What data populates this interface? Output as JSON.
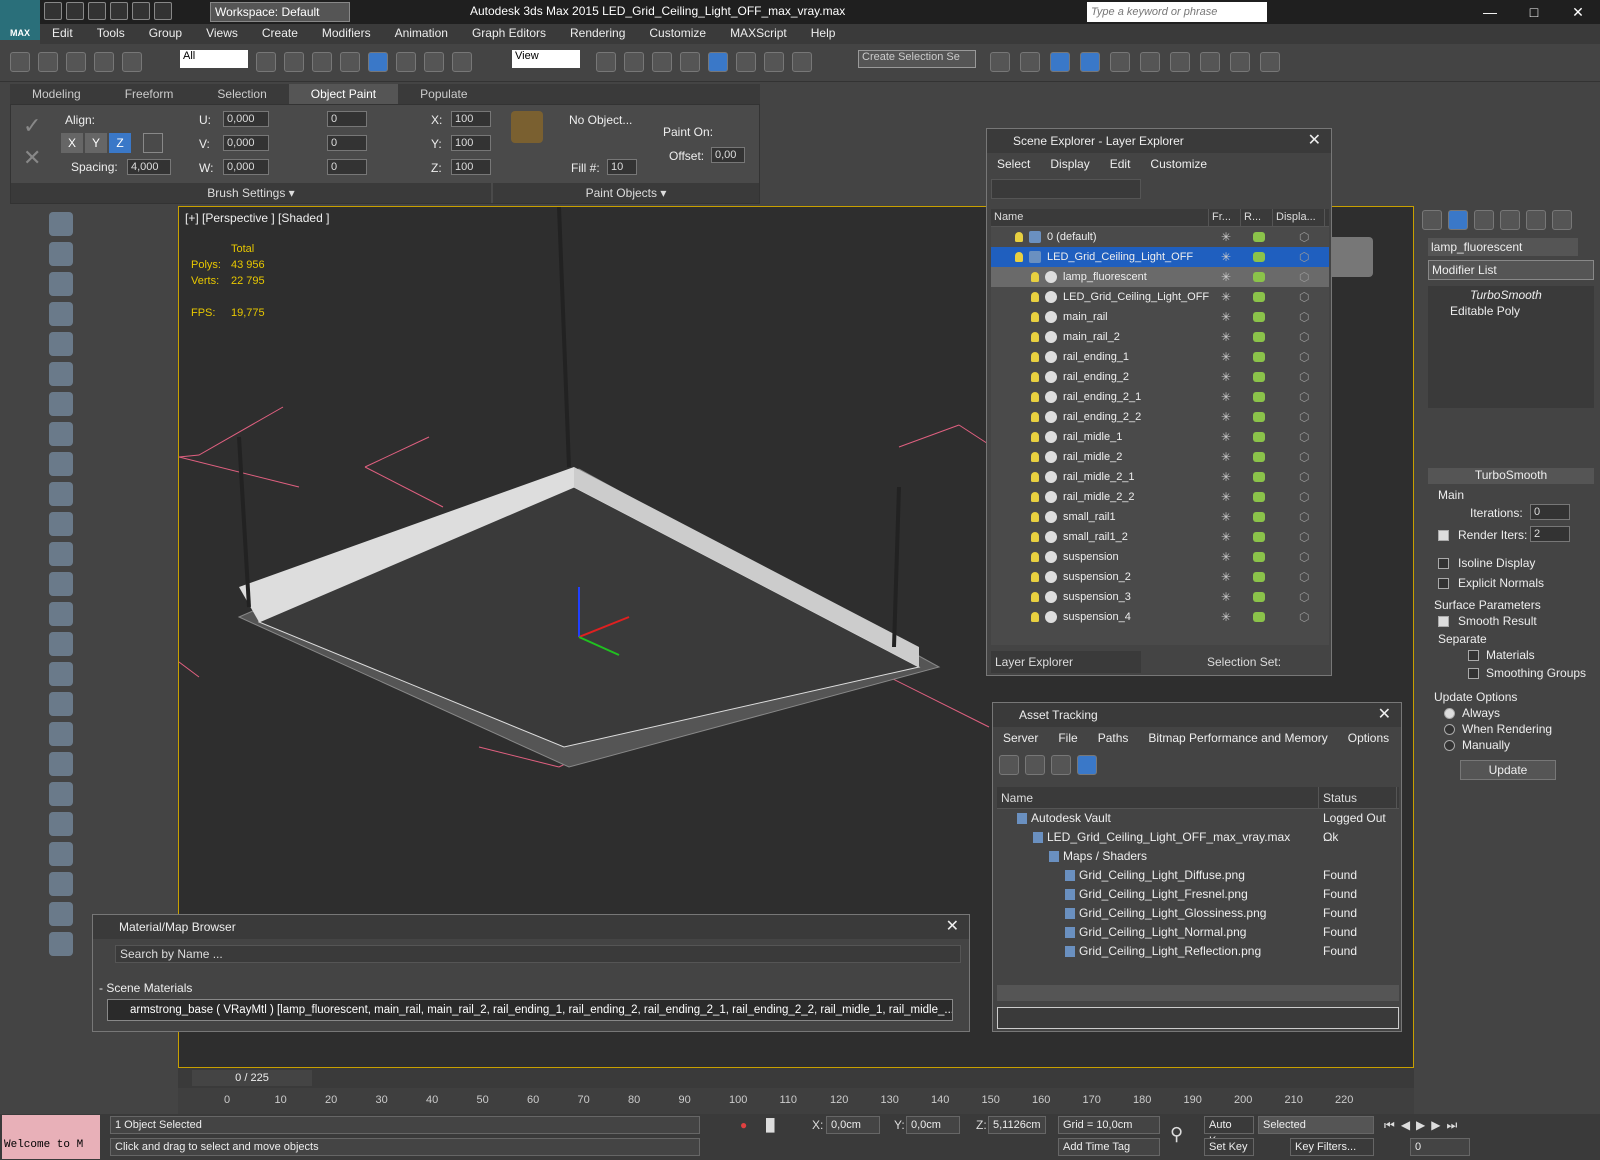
{
  "app": {
    "title": "Autodesk 3ds Max  2015    LED_Grid_Ceiling_Light_OFF_max_vray.max",
    "logo": "MAX",
    "workspace": "Workspace: Default",
    "search_placeholder": "Type a keyword or phrase"
  },
  "menubar": [
    "Edit",
    "Tools",
    "Group",
    "Views",
    "Create",
    "Modifiers",
    "Animation",
    "Graph Editors",
    "Rendering",
    "Customize",
    "MAXScript",
    "Help"
  ],
  "toolbar": {
    "selection_filter": "All",
    "reference_coord": "View",
    "selection_set_placeholder": "Create Selection Se"
  },
  "ribbon": {
    "tabs": [
      "Modeling",
      "Freeform",
      "Selection",
      "Object Paint",
      "Populate"
    ],
    "active_tab": "Object Paint",
    "align_label": "Align:",
    "axes": [
      "X",
      "Y",
      "Z"
    ],
    "spacing_label": "Spacing:",
    "spacing_value": "4,000",
    "u_label": "U:",
    "u_value": "0,000",
    "v_label": "V:",
    "v_value": "0,000",
    "w_label": "W:",
    "w_value": "0,000",
    "x_rot": "0",
    "y_rot": "0",
    "z_rot": "0",
    "x_scale_label": "X:",
    "x_scale": "100",
    "y_scale_label": "Y:",
    "y_scale": "100",
    "z_scale_label": "Z:",
    "z_scale": "100",
    "no_object": "No Object...",
    "fill_label": "Fill #:",
    "fill_value": "10",
    "paint_on_label": "Paint On:",
    "offset_label": "Offset:",
    "offset_value": "0,00",
    "brush_settings": "Brush Settings",
    "paint_objects": "Paint Objects"
  },
  "viewport": {
    "label": "[+] [Perspective ] [Shaded ]",
    "stats_total": "Total",
    "polys_label": "Polys:",
    "polys": "43 956",
    "verts_label": "Verts:",
    "verts": "22 795",
    "fps_label": "FPS:",
    "fps": "19,775"
  },
  "scene_explorer": {
    "title": "Scene Explorer - Layer Explorer",
    "menu": [
      "Select",
      "Display",
      "Edit",
      "Customize"
    ],
    "columns": [
      "Name",
      "Fr...",
      "R...",
      "Displa..."
    ],
    "rows": [
      {
        "name": "0 (default)",
        "level": 0,
        "kind": "layer"
      },
      {
        "name": "LED_Grid_Ceiling_Light_OFF",
        "level": 0,
        "kind": "layer",
        "selected": true
      },
      {
        "name": "lamp_fluorescent",
        "level": 1,
        "kind": "object",
        "highlight": true
      },
      {
        "name": "LED_Grid_Ceiling_Light_OFF",
        "level": 1,
        "kind": "group"
      },
      {
        "name": "main_rail",
        "level": 1,
        "kind": "object"
      },
      {
        "name": "main_rail_2",
        "level": 1,
        "kind": "object"
      },
      {
        "name": "rail_ending_1",
        "level": 1,
        "kind": "object"
      },
      {
        "name": "rail_ending_2",
        "level": 1,
        "kind": "object"
      },
      {
        "name": "rail_ending_2_1",
        "level": 1,
        "kind": "object"
      },
      {
        "name": "rail_ending_2_2",
        "level": 1,
        "kind": "object"
      },
      {
        "name": "rail_midle_1",
        "level": 1,
        "kind": "object"
      },
      {
        "name": "rail_midle_2",
        "level": 1,
        "kind": "object"
      },
      {
        "name": "rail_midle_2_1",
        "level": 1,
        "kind": "object"
      },
      {
        "name": "rail_midle_2_2",
        "level": 1,
        "kind": "object"
      },
      {
        "name": "small_rail1",
        "level": 1,
        "kind": "object"
      },
      {
        "name": "small_rail1_2",
        "level": 1,
        "kind": "object"
      },
      {
        "name": "suspension",
        "level": 1,
        "kind": "object"
      },
      {
        "name": "suspension_2",
        "level": 1,
        "kind": "object"
      },
      {
        "name": "suspension_3",
        "level": 1,
        "kind": "object"
      },
      {
        "name": "suspension_4",
        "level": 1,
        "kind": "object"
      }
    ],
    "footer_explorer": "Layer Explorer",
    "footer_selset": "Selection Set:"
  },
  "asset_tracking": {
    "title": "Asset Tracking",
    "menu": [
      "Server",
      "File",
      "Paths",
      "Bitmap Performance and Memory",
      "Options"
    ],
    "columns": [
      "Name",
      "Status"
    ],
    "rows": [
      {
        "name": "Autodesk Vault",
        "status": "Logged Out ...",
        "indent": 1
      },
      {
        "name": "LED_Grid_Ceiling_Light_OFF_max_vray.max",
        "status": "Ok",
        "indent": 2
      },
      {
        "name": "Maps / Shaders",
        "status": "",
        "indent": 3
      },
      {
        "name": "Grid_Ceiling_Light_Diffuse.png",
        "status": "Found",
        "indent": 4
      },
      {
        "name": "Grid_Ceiling_Light_Fresnel.png",
        "status": "Found",
        "indent": 4
      },
      {
        "name": "Grid_Ceiling_Light_Glossiness.png",
        "status": "Found",
        "indent": 4
      },
      {
        "name": "Grid_Ceiling_Light_Normal.png",
        "status": "Found",
        "indent": 4
      },
      {
        "name": "Grid_Ceiling_Light_Reflection.png",
        "status": "Found",
        "indent": 4
      }
    ]
  },
  "material_browser": {
    "title": "Material/Map Browser",
    "search_placeholder": "Search by Name ...",
    "section": "- Scene Materials",
    "item": "armstrong_base  ( VRayMtl ) [lamp_fluorescent, main_rail, main_rail_2, rail_ending_1, rail_ending_2, rail_ending_2_1, rail_ending_2_2, rail_midle_1, rail_midle_..."
  },
  "command_panel": {
    "object_name": "lamp_fluorescent",
    "modifier_list": "Modifier List",
    "stack": [
      "TurboSmooth",
      "Editable Poly"
    ],
    "rollout_title": "TurboSmooth",
    "main_label": "Main",
    "iterations_label": "Iterations:",
    "iterations": "0",
    "render_iters_label": "Render Iters:",
    "render_iters": "2",
    "isoline": "Isoline Display",
    "explicit_normals": "Explicit Normals",
    "surface_params": "Surface Parameters",
    "smooth_result": "Smooth Result",
    "separate": "Separate",
    "materials": "Materials",
    "smoothing_groups": "Smoothing Groups",
    "update_options": "Update Options",
    "always": "Always",
    "when_rendering": "When Rendering",
    "manually": "Manually",
    "update_btn": "Update"
  },
  "timeline": {
    "frame": "0 / 225",
    "ticks": [
      "0",
      "10",
      "20",
      "30",
      "40",
      "50",
      "60",
      "70",
      "80",
      "90",
      "100",
      "110",
      "120",
      "130",
      "140",
      "150",
      "160",
      "170",
      "180",
      "190",
      "200",
      "210",
      "220"
    ]
  },
  "status": {
    "welcome": "Welcome to M",
    "selected": "1 Object Selected",
    "prompt": "Click and drag to select and move objects",
    "x_label": "X:",
    "x": "0,0cm",
    "y_label": "Y:",
    "y": "0,0cm",
    "z_label": "Z:",
    "z": "5,1126cm",
    "grid": "Grid = 10,0cm",
    "add_time_tag": "Add Time Tag",
    "auto_key": "Auto Key",
    "set_key": "Set Key",
    "key_mode": "Selected",
    "key_filters": "Key Filters...",
    "frame_value": "0"
  },
  "colors": {
    "viewport_border": "#c8a000",
    "stats": "#e8c800",
    "selection": "#1f5fbf",
    "welcome_bg": "#e8b0b8"
  }
}
